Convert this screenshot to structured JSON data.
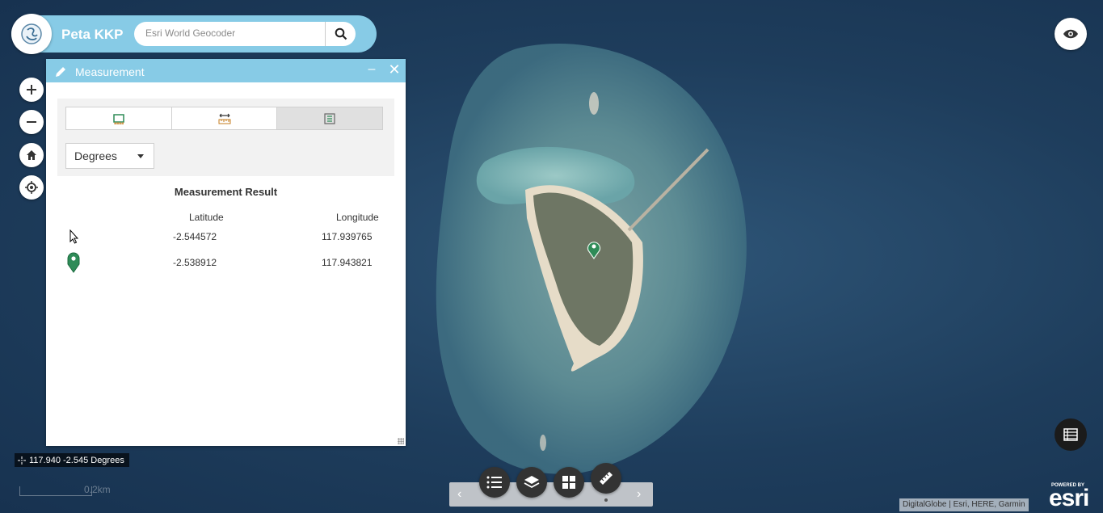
{
  "header": {
    "app_title": "Peta KKP",
    "search_placeholder": "Esri World Geocoder"
  },
  "panel": {
    "title": "Measurement",
    "tools": [
      {
        "name": "area",
        "icon": "area-ruler-icon",
        "active": false
      },
      {
        "name": "distance",
        "icon": "distance-ruler-icon",
        "active": false
      },
      {
        "name": "location",
        "icon": "location-grid-icon",
        "active": true
      }
    ],
    "unit": "Degrees",
    "result_title": "Measurement Result",
    "columns": {
      "latitude": "Latitude",
      "longitude": "Longitude"
    },
    "rows": [
      {
        "icon": "cursor-icon",
        "latitude": "-2.544572",
        "longitude": "117.939765"
      },
      {
        "icon": "green-marker-icon",
        "latitude": "-2.538912",
        "longitude": "117.943821"
      }
    ]
  },
  "coords_readout": "117.940 -2.545 Degrees",
  "scalebar_label": "0.2km",
  "attribution": "DigitalGlobe | Esri, HERE, Garmin",
  "esri": {
    "powered_by": "POWERED BY",
    "logo": "esri"
  },
  "colors": {
    "accent": "#87cbe6",
    "marker": "#2e8b57"
  }
}
